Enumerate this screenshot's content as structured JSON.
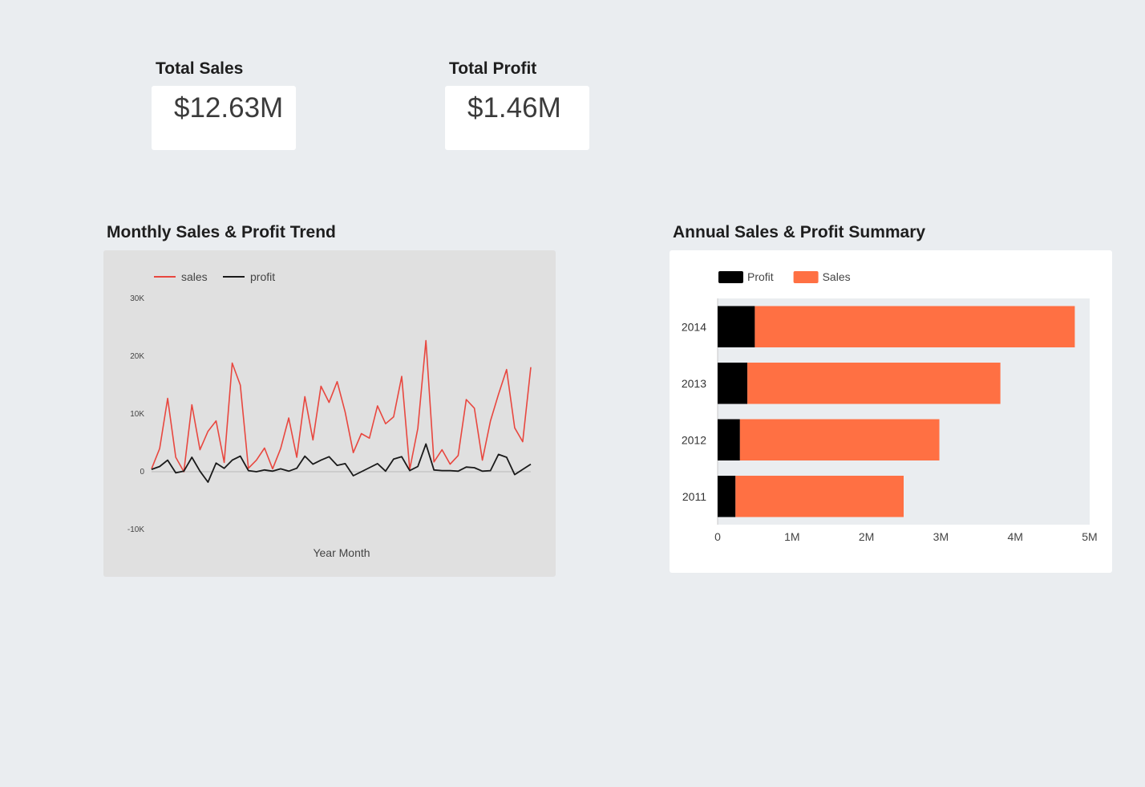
{
  "kpis": {
    "sales": {
      "title": "Total Sales",
      "value": "$12.63M"
    },
    "profit": {
      "title": "Total Profit",
      "value": "$1.46M"
    }
  },
  "colors": {
    "background": "#eaedf0",
    "sales_line": "#e8473f",
    "profit_line": "#1a1a1a",
    "sales_bar": "#ff7043",
    "profit_bar": "#000000",
    "line_panel": "#e0e0e0",
    "bar_plot": "#eaedf0"
  },
  "chart_data": [
    {
      "type": "line",
      "title": "Monthly Sales & Profit Trend",
      "xlabel": "Year Month",
      "ylabel": "",
      "ylim": [
        -10000,
        30000
      ],
      "yticks": [
        30000,
        20000,
        10000,
        0,
        -10000
      ],
      "ytick_labels": [
        "30K",
        "20K",
        "10K",
        "0",
        "-10K"
      ],
      "grid": false,
      "legend_position": "top-left",
      "x": [
        1,
        2,
        3,
        4,
        5,
        6,
        7,
        8,
        9,
        10,
        11,
        12,
        13,
        14,
        15,
        16,
        17,
        18,
        19,
        20,
        21,
        22,
        23,
        24,
        25,
        26,
        27,
        28,
        29,
        30,
        31,
        32,
        33,
        34,
        35,
        36,
        37,
        38,
        39,
        40,
        41,
        42,
        43,
        44,
        45,
        46,
        47,
        48
      ],
      "series": [
        {
          "name": "sales",
          "values": [
            500,
            4000,
            12700,
            2500,
            0,
            11600,
            3800,
            7000,
            8800,
            1600,
            18800,
            15000,
            600,
            2000,
            4100,
            500,
            4000,
            9300,
            2500,
            13000,
            5500,
            14800,
            12000,
            15600,
            10300,
            3300,
            6600,
            5800,
            11400,
            8300,
            9500,
            16500,
            400,
            7500,
            22700,
            1700,
            3800,
            1300,
            2800,
            12500,
            11000,
            2000,
            8800,
            13400,
            17700,
            7600,
            5200,
            18100
          ]
        },
        {
          "name": "profit",
          "values": [
            400,
            900,
            2000,
            -200,
            100,
            2500,
            100,
            -1800,
            1500,
            600,
            2000,
            2700,
            200,
            0,
            300,
            100,
            500,
            100,
            600,
            2700,
            1300,
            2000,
            2600,
            1100,
            1400,
            -700,
            0,
            700,
            1400,
            100,
            2200,
            2600,
            200,
            900,
            4800,
            300,
            200,
            200,
            100,
            800,
            700,
            100,
            200,
            3000,
            2500,
            -500,
            400,
            1300
          ]
        }
      ]
    },
    {
      "type": "bar",
      "orientation": "horizontal",
      "stacked": true,
      "title": "Annual Sales & Profit Summary",
      "categories": [
        "2014",
        "2013",
        "2012",
        "2011"
      ],
      "series": [
        {
          "name": "Profit",
          "values": [
            500000,
            400000,
            300000,
            240000
          ]
        },
        {
          "name": "Sales",
          "values": [
            4300000,
            3400000,
            2680000,
            2260000
          ]
        }
      ],
      "xlim": [
        0,
        5000000
      ],
      "xticks": [
        0,
        1000000,
        2000000,
        3000000,
        4000000,
        5000000
      ],
      "xtick_labels": [
        "0",
        "1M",
        "2M",
        "3M",
        "4M",
        "5M"
      ],
      "legend_position": "top-left"
    }
  ]
}
